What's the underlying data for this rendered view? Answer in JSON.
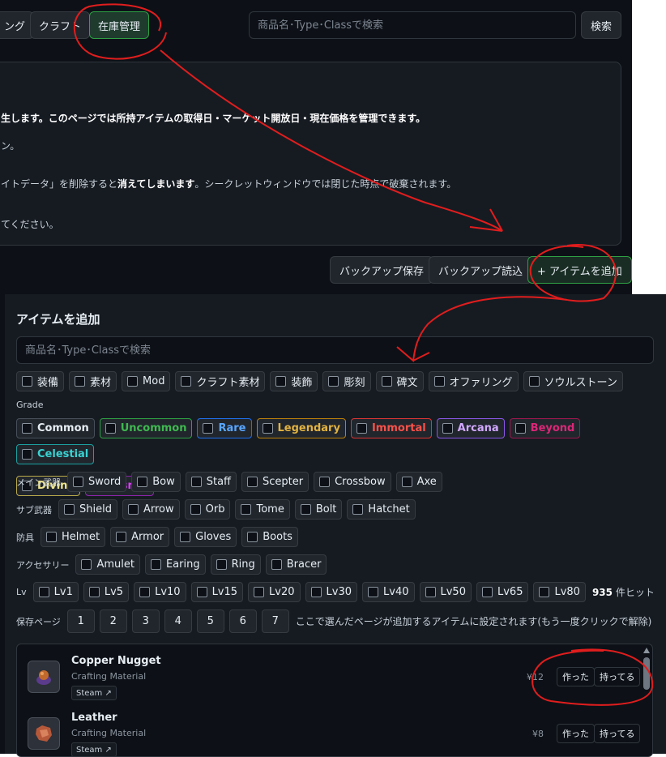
{
  "nav": {
    "tabs": [
      {
        "label": "ング"
      },
      {
        "label": "クラフト"
      },
      {
        "label": "在庫管理"
      }
    ],
    "search_placeholder": "商品名･Type･Classで検索",
    "search_button": "検索"
  },
  "info": {
    "line1_a": "生します。このページでは所持アイテムの取得日・マーケット開放日・現在価格を管理できます。",
    "line2": "ン。",
    "line3_a": "イトデータ」を削除すると",
    "line3_b": "消えてしまいます",
    "line3_c": "。シークレットウィンドウでは閉じた時点で破棄されます。",
    "line4": "てください。"
  },
  "actions": {
    "backup_save": "バックアップ保存",
    "backup_load": "バックアップ読込",
    "add_item": "+ アイテムを追加"
  },
  "modal": {
    "title": "アイテムを追加",
    "search_placeholder": "商品名･Type･Classで検索",
    "categories": [
      "装備",
      "素材",
      "Mod",
      "クラフト素材",
      "装飾",
      "彫刻",
      "碑文",
      "オファリング",
      "ソウルストーン"
    ],
    "grade_label": "Grade",
    "grades": [
      {
        "label": "Common",
        "color": "#e6edf3",
        "border": "#484f58"
      },
      {
        "label": "Uncommon",
        "color": "#3fb950",
        "border": "#2ea043"
      },
      {
        "label": "Rare",
        "color": "#58a6ff",
        "border": "#1f6feb"
      },
      {
        "label": "Legendary",
        "color": "#e3b341",
        "border": "#bb8009"
      },
      {
        "label": "Immortal",
        "color": "#f85149",
        "border": "#da3633"
      },
      {
        "label": "Arcana",
        "color": "#d2a8ff",
        "border": "#8957e5"
      },
      {
        "label": "Beyond",
        "color": "#db2777",
        "border": "#9d174d"
      },
      {
        "label": "Celestial",
        "color": "#39d3d3",
        "border": "#1b9f9f"
      },
      {
        "label": "Divine",
        "color": "#f0e68c",
        "border": "#b8a94a"
      },
      {
        "label": "Cosmic",
        "color": "#e040fb",
        "border": "#8e24aa"
      }
    ],
    "main_weapon": {
      "label": "メイン武器",
      "items": [
        "Sword",
        "Bow",
        "Staff",
        "Scepter",
        "Crossbow",
        "Axe"
      ]
    },
    "sub_weapon": {
      "label": "サブ武器",
      "items": [
        "Shield",
        "Arrow",
        "Orb",
        "Tome",
        "Bolt",
        "Hatchet"
      ]
    },
    "armor": {
      "label": "防具",
      "items": [
        "Helmet",
        "Armor",
        "Gloves",
        "Boots"
      ]
    },
    "accessory": {
      "label": "アクセサリー",
      "items": [
        "Amulet",
        "Earing",
        "Ring",
        "Bracer"
      ]
    },
    "level": {
      "label": "Lv",
      "items": [
        "Lv1",
        "Lv5",
        "Lv10",
        "Lv15",
        "Lv20",
        "Lv30",
        "Lv40",
        "Lv50",
        "Lv65",
        "Lv80"
      ]
    },
    "hit_count": "935",
    "hit_suffix": "件ヒット",
    "save_page": {
      "label": "保存ページ",
      "pages": [
        "1",
        "2",
        "3",
        "4",
        "5",
        "6",
        "7"
      ],
      "note": "ここで選んだページが追加するアイテムに設定されます(もう一度クリックで解除)"
    },
    "items": [
      {
        "name": "Copper Nugget",
        "type": "Crafting Material",
        "steam": "Steam ↗",
        "price": "¥12",
        "made": "作った",
        "owned": "持ってる",
        "icon": "copper-nugget-icon"
      },
      {
        "name": "Leather",
        "type": "Crafting Material",
        "steam": "Steam ↗",
        "price": "¥8",
        "made": "作った",
        "owned": "持ってる",
        "icon": "leather-icon"
      }
    ]
  },
  "colors": {
    "annotation": "#e11d1d",
    "accent_green": "#2ea043"
  }
}
